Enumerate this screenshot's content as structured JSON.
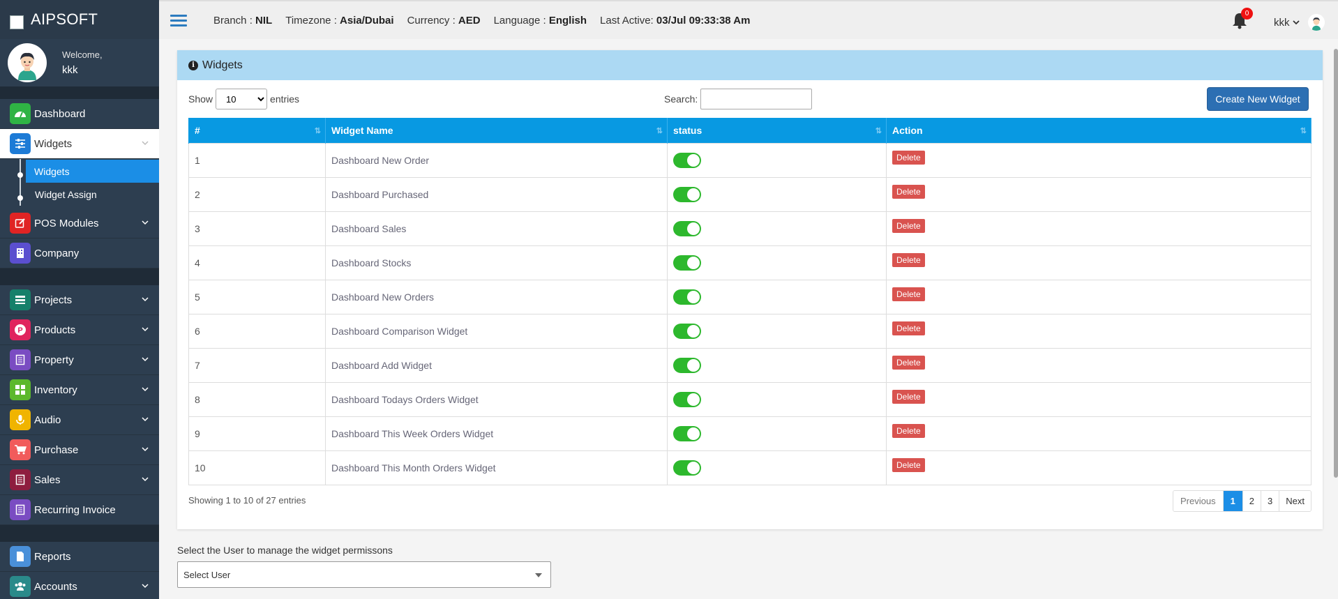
{
  "brand": {
    "name": "AIPSOFT"
  },
  "user_panel": {
    "welcome": "Welcome,",
    "username": "kkk"
  },
  "sidebar": {
    "items": [
      {
        "label": "Dashboard",
        "icon": "dashboard-icon",
        "color": "#2fb344"
      },
      {
        "label": "Widgets",
        "icon": "sliders-icon",
        "color": "#1d7bd6"
      },
      {
        "label": "POS Modules",
        "icon": "edit-icon",
        "color": "#e02424"
      },
      {
        "label": "Company",
        "icon": "building-icon",
        "color": "#5b4fcf"
      },
      {
        "label": "Projects",
        "icon": "projects-icon",
        "color": "#16806a"
      },
      {
        "label": "Products",
        "icon": "product-icon",
        "color": "#e0245e"
      },
      {
        "label": "Property",
        "icon": "property-icon",
        "color": "#7a4cc2"
      },
      {
        "label": "Inventory",
        "icon": "grid-icon",
        "color": "#5cb82c"
      },
      {
        "label": "Audio",
        "icon": "microphone-icon",
        "color": "#f0b400"
      },
      {
        "label": "Purchase",
        "icon": "cart-icon",
        "color": "#f15b5b"
      },
      {
        "label": "Sales",
        "icon": "sales-icon",
        "color": "#8e1d3f"
      },
      {
        "label": "Recurring Invoice",
        "icon": "invoice-icon",
        "color": "#7a4cc2"
      },
      {
        "label": "Reports",
        "icon": "file-icon",
        "color": "#4a90d9"
      },
      {
        "label": "Accounts",
        "icon": "users-icon",
        "color": "#2a8a8a"
      }
    ],
    "submenu": [
      {
        "label": "Widgets"
      },
      {
        "label": "Widget Assign"
      }
    ]
  },
  "header": {
    "branch_label": "Branch :",
    "branch_value": "NIL",
    "timezone_label": "Timezone :",
    "timezone_value": "Asia/Dubai",
    "currency_label": "Currency :",
    "currency_value": "AED",
    "language_label": "Language :",
    "language_value": "English",
    "last_active_label": "Last Active:",
    "last_active_value": "03/Jul 09:33:38 Am",
    "notification_count": "0",
    "user_menu": "kkk"
  },
  "card": {
    "title": "Widgets",
    "show_label": "Show",
    "entries_label": "entries",
    "page_length": "10",
    "search_label": "Search:",
    "search_value": "",
    "create_button": "Create New Widget",
    "columns": [
      "#",
      "Widget Name",
      "status",
      "Action"
    ],
    "rows": [
      {
        "num": "1",
        "name": "Dashboard New Order",
        "status": "on",
        "action": "Delete"
      },
      {
        "num": "2",
        "name": "Dashboard Purchased",
        "status": "on",
        "action": "Delete"
      },
      {
        "num": "3",
        "name": "Dashboard Sales",
        "status": "on",
        "action": "Delete"
      },
      {
        "num": "4",
        "name": "Dashboard Stocks",
        "status": "on",
        "action": "Delete"
      },
      {
        "num": "5",
        "name": "Dashboard New Orders",
        "status": "on",
        "action": "Delete"
      },
      {
        "num": "6",
        "name": "Dashboard Comparison Widget",
        "status": "on",
        "action": "Delete"
      },
      {
        "num": "7",
        "name": "Dashboard Add Widget",
        "status": "on",
        "action": "Delete"
      },
      {
        "num": "8",
        "name": "Dashboard Todays Orders Widget",
        "status": "on",
        "action": "Delete"
      },
      {
        "num": "9",
        "name": "Dashboard This Week Orders Widget",
        "status": "on",
        "action": "Delete"
      },
      {
        "num": "10",
        "name": "Dashboard This Month Orders Widget",
        "status": "on",
        "action": "Delete"
      }
    ],
    "showing_text": "Showing 1 to 10 of 27 entries",
    "pagination": {
      "previous": "Previous",
      "pages": [
        "1",
        "2",
        "3"
      ],
      "current": "1",
      "next": "Next"
    }
  },
  "permissions": {
    "label": "Select the User to manage the widget permissons",
    "select_value": "Select User"
  },
  "colors": {
    "accent": "#0899e2",
    "toggle_on": "#2db82d",
    "delete": "#d9534f",
    "card_header": "#acd9f3"
  }
}
